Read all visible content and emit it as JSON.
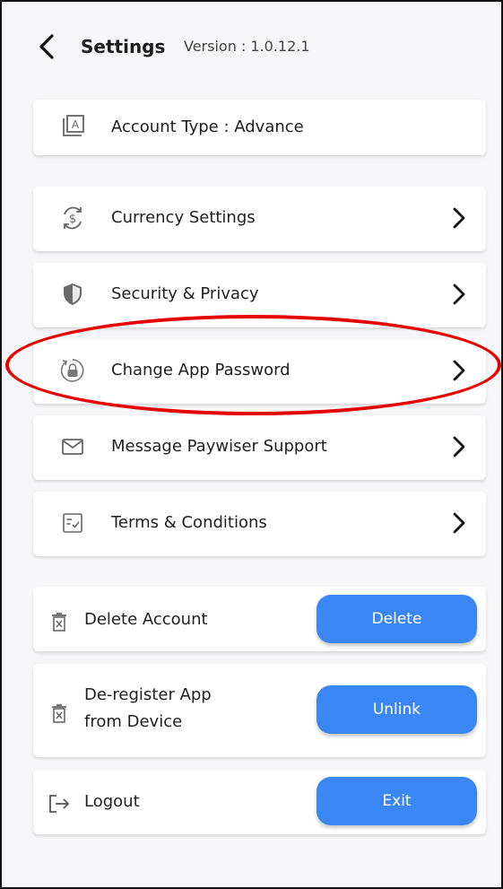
{
  "header": {
    "title": "Settings",
    "version": "Version : 1.0.12.1"
  },
  "account_type": {
    "label": "Account Type : Advance"
  },
  "menu": [
    {
      "label": "Currency Settings",
      "icon": "currency-exchange-icon"
    },
    {
      "label": "Security & Privacy",
      "icon": "shield-icon"
    },
    {
      "label": "Change App Password",
      "icon": "lock-refresh-icon"
    },
    {
      "label": "Message Paywiser Support",
      "icon": "envelope-icon"
    },
    {
      "label": "Terms & Conditions",
      "icon": "checklist-icon"
    }
  ],
  "actions": {
    "delete_account": {
      "label": "Delete Account",
      "button": "Delete"
    },
    "deregister": {
      "label_line1": "De-register App",
      "label_line2": "from Device",
      "button": "Unlink"
    },
    "logout": {
      "label": "Logout",
      "button": "Exit"
    }
  },
  "colors": {
    "accent": "#3a86f3",
    "highlight": "#e60000",
    "background": "#f6f6f8"
  }
}
